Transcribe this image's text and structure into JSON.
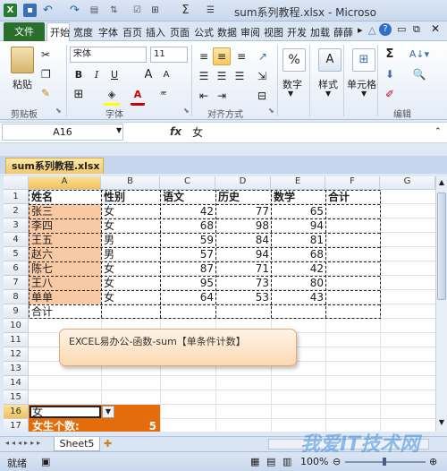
{
  "window": {
    "title": "sum系列教程.xlsx - Microso",
    "qat_icons": [
      "excel-logo-icon",
      "save-icon",
      "undo-icon",
      "redo-icon",
      "paste-icon",
      "sort-icon",
      "checkbox-icon",
      "grid-icon",
      "sigma-icon",
      "align-icon"
    ]
  },
  "ribbon": {
    "file_tab": "文件",
    "tabs": [
      "开始",
      "宽度",
      "字体",
      "百页",
      "插入",
      "页面",
      "公式",
      "数据",
      "审阅",
      "视图",
      "开发",
      "加载",
      "薛薛"
    ],
    "clipboard": {
      "paste_label": "粘贴",
      "group_label": "剪贴板"
    },
    "font": {
      "name": "宋体",
      "size": "11",
      "bold": "B",
      "italic": "I",
      "underline": "U",
      "grow": "A",
      "shrink": "A",
      "color_a": "A",
      "group_label": "字体"
    },
    "alignment": {
      "group_label": "对齐方式"
    },
    "number": {
      "label": "数字",
      "percent": "%"
    },
    "styles": {
      "label": "样式"
    },
    "cells": {
      "label": "单元格"
    },
    "editing": {
      "group_label": "编辑",
      "sigma": "Σ"
    }
  },
  "formula_bar": {
    "name_box": "A16",
    "fx": "fx",
    "content": "女"
  },
  "workbook": {
    "tab_name": "sum系列教程.xlsx"
  },
  "sheet": {
    "columns": [
      "A",
      "B",
      "C",
      "D",
      "E",
      "F",
      "G"
    ],
    "rows": [
      "1",
      "2",
      "3",
      "4",
      "5",
      "6",
      "7",
      "8",
      "9",
      "10",
      "11",
      "12",
      "13",
      "14",
      "15",
      "16",
      "17"
    ],
    "headers": [
      "姓名",
      "性别",
      "语文",
      "历史",
      "数学",
      "合计"
    ],
    "data": [
      [
        "张三",
        "女",
        "42",
        "77",
        "65"
      ],
      [
        "李四",
        "女",
        "68",
        "98",
        "94"
      ],
      [
        "王五",
        "男",
        "59",
        "84",
        "81"
      ],
      [
        "赵六",
        "男",
        "57",
        "94",
        "68"
      ],
      [
        "陈七",
        "女",
        "87",
        "71",
        "42"
      ],
      [
        "王八",
        "女",
        "95",
        "73",
        "80"
      ],
      [
        "单单",
        "女",
        "64",
        "53",
        "43"
      ]
    ],
    "total_label": "合计",
    "a16_value": "女",
    "a17_label": "女生个数:",
    "result_value": "5",
    "colors": {
      "name_fill": "#f9c9a4",
      "orange": "#e46c0a",
      "header_fill": "#ffffff"
    }
  },
  "callout": {
    "text": "EXCEL易办公-函数-sum【单条件计数】"
  },
  "sheet_tabs": {
    "active": "Sheet5"
  },
  "status": {
    "ready": "就绪",
    "zoom": "100%"
  },
  "watermark": {
    "text": "我爱IT技术网"
  }
}
